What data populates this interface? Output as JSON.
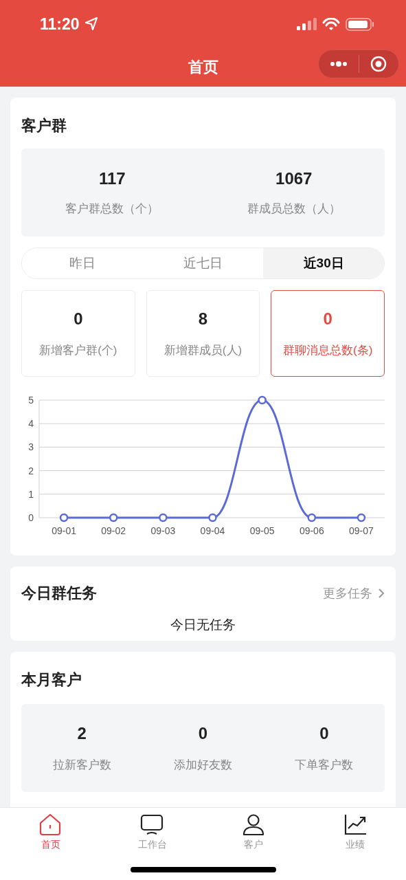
{
  "status_bar": {
    "time": "11:20"
  },
  "nav": {
    "title": "首页"
  },
  "customer_groups": {
    "title": "客户群",
    "summary": [
      {
        "value": "117",
        "label": "客户群总数（个）"
      },
      {
        "value": "1067",
        "label": "群成员总数（人）"
      }
    ],
    "periods": [
      {
        "label": "昨日",
        "selected": false
      },
      {
        "label": "近七日",
        "selected": false
      },
      {
        "label": "近30日",
        "selected": true
      }
    ],
    "stats": [
      {
        "value": "0",
        "label": "新增客户群(个)",
        "selected": false
      },
      {
        "value": "8",
        "label": "新增群成员(人)",
        "selected": false
      },
      {
        "value": "0",
        "label": "群聊消息总数(条)",
        "selected": true
      }
    ],
    "chart_data": {
      "type": "line",
      "categories": [
        "09-01",
        "09-02",
        "09-03",
        "09-04",
        "09-05",
        "09-06",
        "09-07"
      ],
      "series": [
        {
          "color": "#5b6ad6",
          "marker": "circle",
          "values": [
            0,
            0,
            0,
            0,
            5,
            0,
            0
          ]
        }
      ],
      "grid": true,
      "ylim": [
        0,
        5
      ],
      "yticks": [
        0,
        1,
        2,
        3,
        4,
        5
      ]
    }
  },
  "today_tasks": {
    "title": "今日群任务",
    "more_link": "更多任务",
    "empty_text": "今日无任务"
  },
  "month_customers": {
    "title": "本月客户",
    "stats": [
      {
        "value": "2",
        "label": "拉新客户数"
      },
      {
        "value": "0",
        "label": "添加好友数"
      },
      {
        "value": "0",
        "label": "下单客户数"
      }
    ]
  },
  "tab_bar": [
    {
      "label": "首页",
      "kind": "home",
      "selected": true
    },
    {
      "label": "工作台",
      "kind": "desk",
      "selected": false
    },
    {
      "label": "客户",
      "kind": "person",
      "selected": false
    },
    {
      "label": "业绩",
      "kind": "trend",
      "selected": false
    }
  ]
}
